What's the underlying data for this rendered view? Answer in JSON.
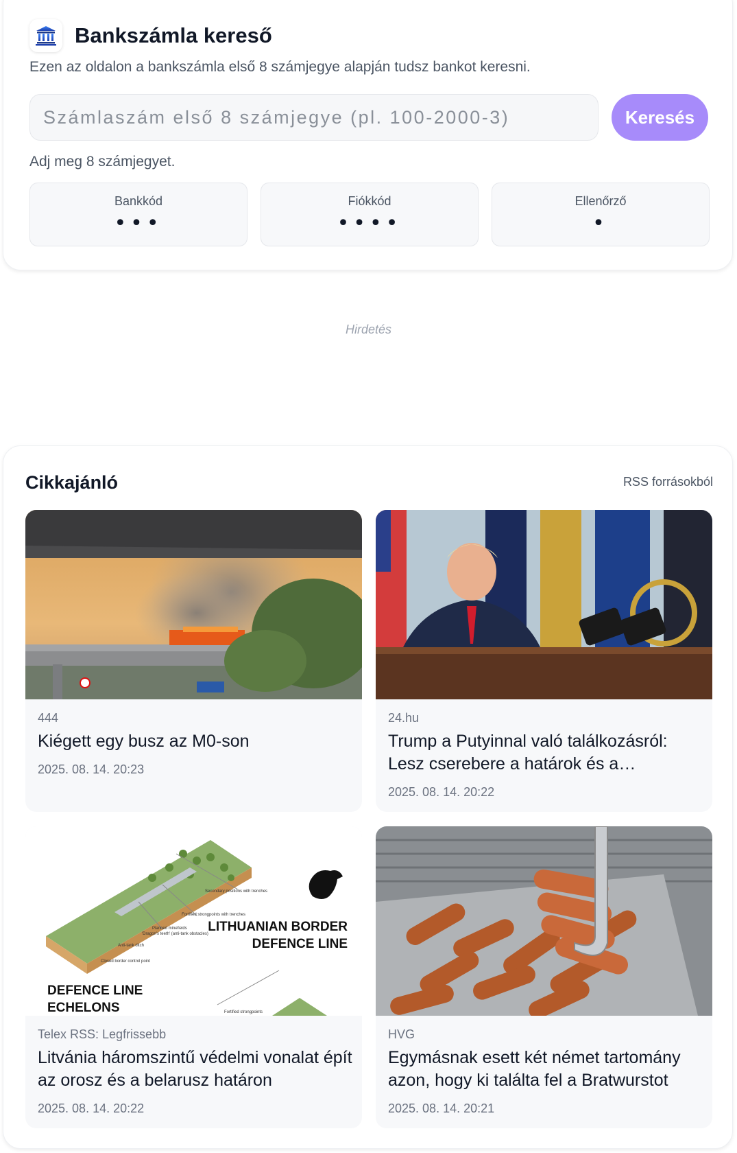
{
  "search": {
    "title": "Bankszámla kereső",
    "subtitle": "Ezen az oldalon a bankszámla első 8 számjegye alapján tudsz bankot keresni.",
    "placeholder": "Számlaszám első 8 számjegye (pl. 100-2000-3)",
    "value": "",
    "button_label": "Keresés",
    "hint": "Adj meg 8 számjegyet.",
    "segments": [
      {
        "label": "Bankkód",
        "dots": "•••"
      },
      {
        "label": "Fiókkód",
        "dots": "••••"
      },
      {
        "label": "Ellenőrző",
        "dots": "•"
      }
    ]
  },
  "ad": {
    "label": "Hirdetés"
  },
  "articles": {
    "title": "Cikkajánló",
    "source_label": "RSS forrásokból",
    "items": [
      {
        "source": "444",
        "headline": "Kiégett egy busz az M0-son",
        "date": "2025. 08. 14. 20:23",
        "image": "bus-fire-photo"
      },
      {
        "source": "24.hu",
        "headline": "Trump a Putyinnal való találkozásról: Lesz cserebere a határok és a területek…",
        "date": "2025. 08. 14. 20:22",
        "image": "oval-office-photo"
      },
      {
        "source": "Telex RSS: Legfrissebb",
        "headline": "Litvánia háromszintű védelmi vonalat épít az orosz és a belarusz határon",
        "date": "2025. 08. 14. 20:22",
        "image": "border-defence-diagram",
        "image_text": {
          "title_line1": "LITHUANIAN BORDER",
          "title_line2": "DEFENCE LINE",
          "subtitle_line1": "DEFENCE LINE",
          "subtitle_line2": "ECHELONS",
          "callouts": [
            "Secondary positions with trenches",
            "Fortified strongpoints with trenches",
            "Planned minefields",
            "'Dragon's teeth' (anti-tank obstacles)",
            "Anti-tank ditch",
            "Closed border control point",
            "Fortified strongpoints"
          ]
        }
      },
      {
        "source": "HVG",
        "headline": "Egymásnak esett két német tartomány azon, hogy ki találta fel a Bratwurstot",
        "date": "2025. 08. 14. 20:21",
        "image": "bratwurst-grill-photo"
      }
    ]
  },
  "colors": {
    "accent": "#a78bfa",
    "card_bg": "#f7f8fa",
    "muted_text": "#6b7280"
  }
}
